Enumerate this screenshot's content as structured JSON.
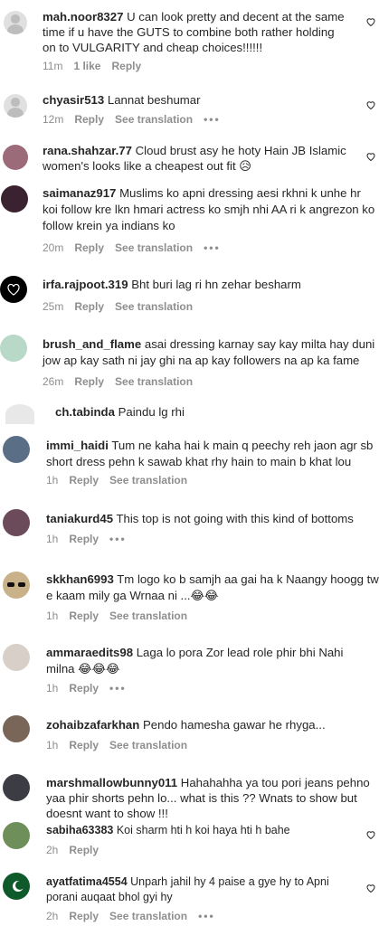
{
  "comments": [
    {
      "user": "mah.noor8327",
      "text": "U can look pretty and decent at the same time if u have the GUTS to combine both rather holding on to VULGARITY and cheap choices!!!!!!",
      "time": "11m",
      "likes": "1 like",
      "reply": "Reply"
    },
    {
      "user": "chyasir513",
      "text": "Lannat beshumar",
      "time": "12m",
      "reply": "Reply",
      "see": "See translation",
      "more": "•••"
    },
    {
      "user": "rana.shahzar.77",
      "text": "Cloud brust asy he hoty Hain JB Islamic women's looks like a cheapest out fit 😥"
    },
    {
      "user": "saimanaz917",
      "text": "Muslims ko apni dressing aesi rkhni k unhe hr koi follow kre lkn hmari actress ko smjh nhi AA ri k angrezon ko follow krein ya indians ko",
      "time": "20m",
      "reply": "Reply",
      "see": "See translation",
      "more": "•••"
    },
    {
      "user": "irfa.rajpoot.319",
      "text": "Bht buri lag ri hn zehar besharm",
      "time": "25m",
      "reply": "Reply",
      "see": "See translation"
    },
    {
      "user": "brush_and_flame",
      "text": "asai dressing karnay say kay milta hay duni jow ap kay sath ni jay ghi na ap kay followers na ap ka fame",
      "time": "26m",
      "reply": "Reply",
      "see": "See translation"
    },
    {
      "user": "ch.tabinda",
      "text": "Paindu lg rhi"
    },
    {
      "user": "immi_haidi",
      "text": "Tum ne kaha hai k main q peechy reh jaon agr sb short dress pehn k sawab khat rhy hain to main b khat lou",
      "time": "1h",
      "reply": "Reply",
      "see": "See translation"
    },
    {
      "user": "taniakurd45",
      "text": "This top is not going with this kind of bottoms",
      "time": "1h",
      "reply": "Reply",
      "more": "•••"
    },
    {
      "user": "skkhan6993",
      "text": "Tm logo ko b samjh aa gai ha k Naangy hoogg tw e kaam mily ga Wrnaa ni ...😂😂",
      "time": "1h",
      "reply": "Reply",
      "see": "See translation"
    },
    {
      "user": "ammaraedits98",
      "text": "Laga lo pora Zor lead role phir bhi Nahi milna 😂😂😂",
      "time": "1h",
      "reply": "Reply",
      "more": "•••"
    },
    {
      "user": "zohaibzafarkhan",
      "text": "Pendo hamesha gawar he rhyga...",
      "time": "1h",
      "reply": "Reply",
      "see": "See translation"
    },
    {
      "user": "marshmallowbunny011",
      "text": "Hahahahha ya tou pori jeans pehno yaa phir shorts pehn lo... what is this ?? Wnats to show but doesnt want to show !!!"
    },
    {
      "user": "sabiha63383",
      "text": "Koi sharm hti h koi haya hti h bahe",
      "time": "2h",
      "reply": "Reply"
    },
    {
      "user": "ayatfatima4554",
      "text": "Unparh jahil hy 4 paise a gye hy to Apni porani auqaat bhol gyi hy",
      "time": "2h",
      "reply": "Reply",
      "see": "See translation",
      "more": "•••"
    }
  ]
}
